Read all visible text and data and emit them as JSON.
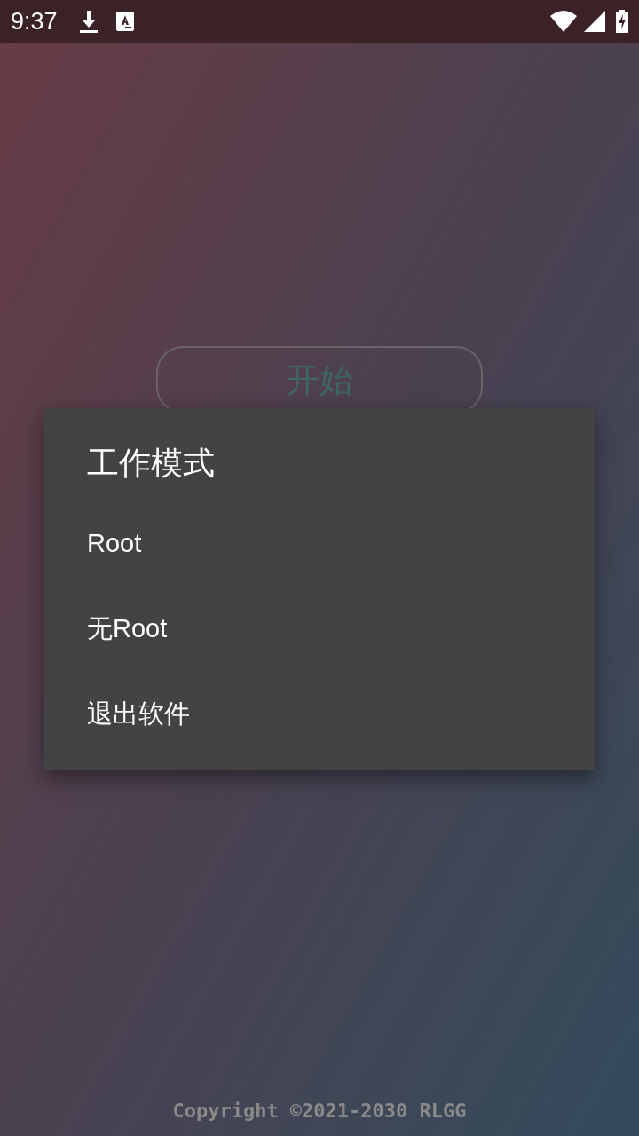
{
  "status_bar": {
    "time": "9:37"
  },
  "start_button": {
    "label": "开始"
  },
  "dialog": {
    "title": "工作模式",
    "options": [
      {
        "label": "Root"
      },
      {
        "label": "无Root"
      },
      {
        "label": "退出软件"
      }
    ]
  },
  "footer": {
    "copyright": "Copyright ©2021-2030 RLGG"
  }
}
